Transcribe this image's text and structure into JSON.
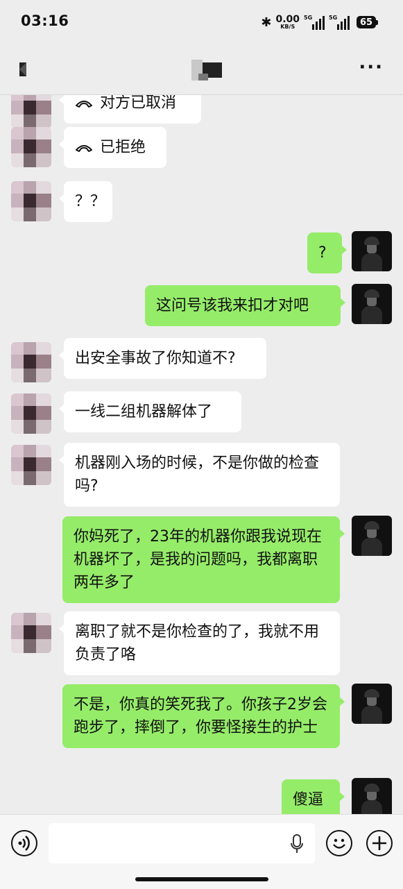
{
  "status_bar": {
    "time": "03:16",
    "speed_value": "0.00",
    "speed_unit": "KB/S",
    "signal_1": "5G",
    "signal_2": "5G",
    "battery": "65"
  },
  "header": {
    "back_icon": "back-arrow-icon",
    "more_icon": "ellipsis-icon"
  },
  "messages": [
    {
      "side": "left",
      "type": "call",
      "text": "对方已取消"
    },
    {
      "side": "left",
      "type": "call",
      "text": "已拒绝"
    },
    {
      "side": "left",
      "type": "text",
      "text": "？？"
    },
    {
      "side": "right",
      "type": "text",
      "text": "?"
    },
    {
      "side": "right",
      "type": "text",
      "text": "这问号该我来扣才对吧"
    },
    {
      "side": "left",
      "type": "text",
      "text": "出安全事故了你知道不?"
    },
    {
      "side": "left",
      "type": "text",
      "text": "一线二组机器解体了"
    },
    {
      "side": "left",
      "type": "text",
      "text": "机器刚入场的时候，不是你做的检查吗?"
    },
    {
      "side": "right",
      "type": "text",
      "text": "你妈死了，23年的机器你跟我说现在机器坏了，是我的问题吗，我都离职两年多了"
    },
    {
      "side": "left",
      "type": "text",
      "text": "离职了就不是你检查的了，我就不用负责了咯"
    },
    {
      "side": "right",
      "type": "text",
      "text": "不是，你真的笑死我了。你孩子2岁会跑步了，摔倒了，你要怪接生的护士"
    },
    {
      "side": "right",
      "type": "text",
      "text": "傻逼"
    }
  ],
  "input_bar": {
    "voice_icon": "voice-icon",
    "mic_icon": "microphone-icon",
    "emoji_icon": "emoji-icon",
    "plus_icon": "plus-icon"
  },
  "colors": {
    "background": "#ededed",
    "bubble_left": "#ffffff",
    "bubble_right": "#95ec69"
  }
}
